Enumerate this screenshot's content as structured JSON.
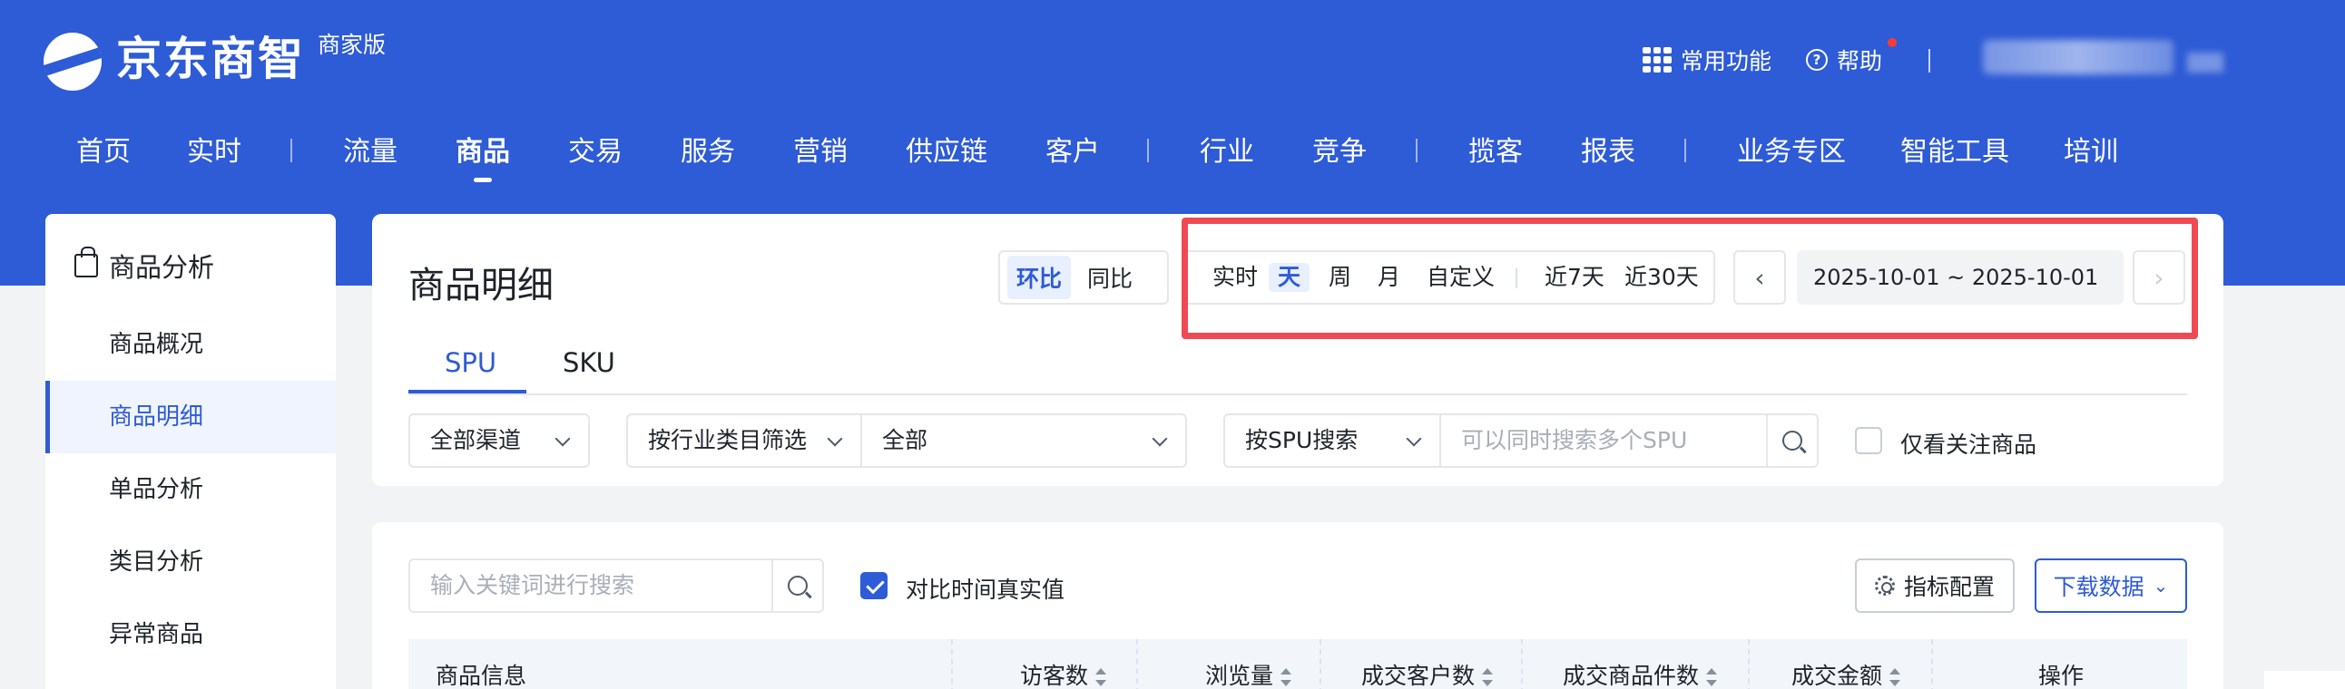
{
  "brand": {
    "name": "京东商智",
    "edition": "商家版"
  },
  "topbar": {
    "common_functions": "常用功能",
    "help": "帮助"
  },
  "nav": {
    "items": [
      "首页",
      "实时",
      "流量",
      "商品",
      "交易",
      "服务",
      "营销",
      "供应链",
      "客户",
      "行业",
      "竞争",
      "揽客",
      "报表",
      "业务专区",
      "智能工具",
      "培训"
    ],
    "active": "商品"
  },
  "sidebar": {
    "title": "商品分析",
    "items": [
      {
        "label": "商品概况"
      },
      {
        "label": "商品明细",
        "active": true
      },
      {
        "label": "单品分析"
      },
      {
        "label": "类目分析"
      },
      {
        "label": "异常商品"
      }
    ]
  },
  "page": {
    "title": "商品明细"
  },
  "compare_mode": {
    "options": [
      "环比",
      "同比"
    ],
    "selected": "环比"
  },
  "period": {
    "options": [
      "实时",
      "天",
      "周",
      "月",
      "自定义",
      "近7天",
      "近30天"
    ],
    "selected": "天"
  },
  "date_range": "2025-10-01 ~ 2025-10-01",
  "tabs": {
    "items": [
      "SPU",
      "SKU"
    ],
    "active": "SPU"
  },
  "filters": {
    "channel": "全部渠道",
    "category_filter": "按行业类目筛选",
    "category_value": "全部",
    "search_type": "按SPU搜索",
    "search_placeholder": "可以同时搜索多个SPU",
    "follow_only_label": "仅看关注商品",
    "follow_only": false
  },
  "table_toolbar": {
    "keyword_placeholder": "输入关键词进行搜索",
    "compare_real_value_label": "对比时间真实值",
    "compare_real_value": true,
    "metric_config": "指标配置",
    "download": "下载数据"
  },
  "table": {
    "columns": [
      {
        "label": "商品信息",
        "sortable": false
      },
      {
        "label": "访客数",
        "sortable": true
      },
      {
        "label": "浏览量",
        "sortable": true
      },
      {
        "label": "成交客户数",
        "sortable": true
      },
      {
        "label": "成交商品件数",
        "sortable": true
      },
      {
        "label": "成交金额",
        "sortable": true
      },
      {
        "label": "操作",
        "sortable": false
      }
    ]
  },
  "colors": {
    "brand_blue": "#2e5bd6",
    "highlight_red": "#ef4a54"
  },
  "icons": [
    "jd-logo-icon",
    "grid-icon",
    "help-icon",
    "bag-icon",
    "chevron-left-icon",
    "chevron-right-icon",
    "chevron-down-icon",
    "search-icon",
    "gear-icon",
    "sort-icon"
  ]
}
